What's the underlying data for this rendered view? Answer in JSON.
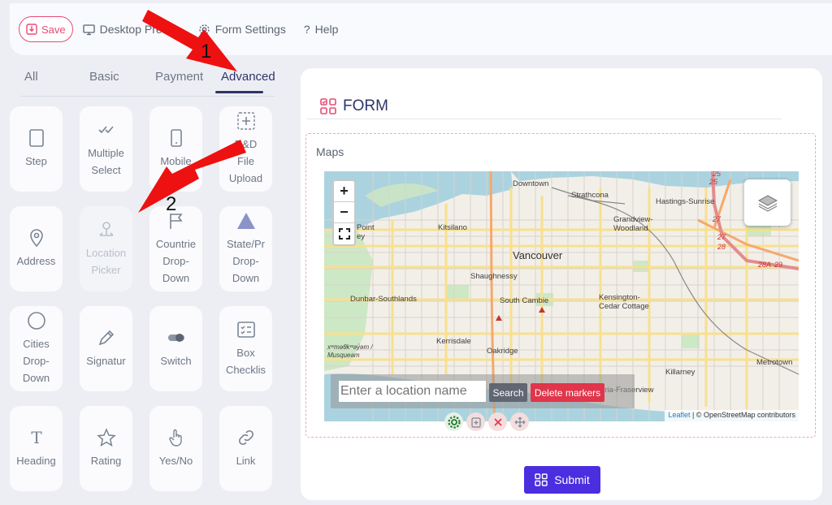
{
  "toolbar": {
    "save_label": "Save",
    "desktop_preview_label": "Desktop Pre",
    "form_settings_label": "Form Settings",
    "help_label": "Help",
    "help_glyph": "?"
  },
  "tabs": [
    {
      "label": "All"
    },
    {
      "label": "Basic"
    },
    {
      "label": "Payment"
    },
    {
      "label": "Advanced",
      "active": true
    }
  ],
  "fields": [
    {
      "label": "Step",
      "icon": "step-icon"
    },
    {
      "label": "Multiple\nSelect",
      "icon": "multiple-select-icon"
    },
    {
      "label": "Mobile",
      "icon": "mobile-icon"
    },
    {
      "label": "D&D\nFile\nUpload",
      "icon": "upload-icon"
    },
    {
      "label": "Address",
      "icon": "location-pin-icon"
    },
    {
      "label": "Location\nPicker",
      "icon": "location-picker-icon"
    },
    {
      "label": "Countrie\nDrop-\nDown",
      "icon": "flag-icon"
    },
    {
      "label": "State/Pr\nDrop-\nDown",
      "icon": "triangle-icon"
    },
    {
      "label": "Cities\nDrop-\nDown",
      "icon": "circle-icon"
    },
    {
      "label": "Signatur",
      "icon": "pen-icon"
    },
    {
      "label": "Switch",
      "icon": "toggle-icon"
    },
    {
      "label": "Box\nChecklis",
      "icon": "checklist-icon"
    },
    {
      "label": "Heading",
      "icon": "heading-icon"
    },
    {
      "label": "Rating",
      "icon": "star-icon"
    },
    {
      "label": "Yes/No",
      "icon": "hand-pointer-icon"
    },
    {
      "label": "Link",
      "icon": "link-icon"
    }
  ],
  "form": {
    "title": "FORM",
    "maps_label": "Maps",
    "submit_label": "Submit"
  },
  "map": {
    "zoom_in": "+",
    "zoom_out": "−",
    "search_placeholder": "Enter a location name",
    "search_button": "Search",
    "delete_button": "Delete markers",
    "attribution_leaflet": "Leaflet",
    "attribution_rest": " | © OpenStreetMap contributors",
    "labels": {
      "downtown": "Downtown",
      "strathcona": "Strathcona",
      "hastings_sunrise": "Hastings-Sunrise",
      "point_grey": "Point\ney",
      "kitsilano": "Kitsilano",
      "grandview_woodland": "Grandview-\nWoodland",
      "vancouver": "Vancouver",
      "shaughnessy": "Shaughnessy",
      "kensington": "Kensington-\nCedar Cottage",
      "dunbar": "Dunbar-Southlands",
      "south_cambie": "South Cambie",
      "kerrisdale": "Kerrisdale",
      "oakridge": "Oakridge",
      "killarney": "Killarney",
      "metrotown": "Metrotown",
      "musqueam": "xʷməθkʷəy̓əm /\nMusqueam",
      "victoria_fraserview": "oria-Fraserview"
    },
    "highway_labels": {
      "h25a": "25",
      "h25b": "25",
      "h27a": "27",
      "h27b": "27",
      "h28": "28",
      "h28a": "28A",
      "h29": "29"
    }
  },
  "annotations": {
    "arrow1": "1",
    "arrow2": "2"
  },
  "colors": {
    "accent": "#2d3569",
    "save": "#e84b76",
    "submit": "#4a2ee0",
    "delete": "#e0354b",
    "arrow": "#ee1111"
  }
}
